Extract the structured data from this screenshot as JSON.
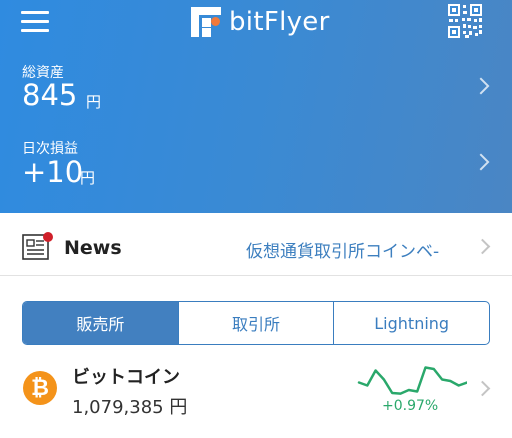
{
  "header": {
    "logo_text": "bitFlyer",
    "icons": {
      "menu": "hamburger-menu-icon",
      "qr": "qr-code-icon",
      "logo": "bitflyer-logo-icon"
    },
    "total_assets": {
      "label": "総資産",
      "value": "845",
      "unit": "円"
    },
    "daily_pnl": {
      "label": "日次損益",
      "value": "+10",
      "unit": "円"
    }
  },
  "news": {
    "title": "News",
    "ticker": "仮想通貨取引所コインベ-",
    "icon": "newspaper-icon"
  },
  "tabs": [
    {
      "label": "販売所",
      "active": true
    },
    {
      "label": "取引所",
      "active": false
    },
    {
      "label": "Lightning",
      "active": false
    }
  ],
  "coins": [
    {
      "name": "ビットコイン",
      "symbol_glyph": "₿",
      "price": "1,079,385 円",
      "change": "+0.97%",
      "sparkline": [
        0.45,
        0.35,
        0.85,
        0.55,
        0.1,
        0.08,
        0.2,
        0.15,
        0.95,
        0.9,
        0.55,
        0.5,
        0.35,
        0.45
      ]
    }
  ],
  "colors": {
    "accent": "#3a7dbf",
    "header_start": "#2f8be0",
    "header_end": "#4a86c4",
    "positive": "#2aa86b",
    "bitcoin": "#f4931a",
    "logo_dot": "#f2793a",
    "news_badge": "#d0202a"
  }
}
